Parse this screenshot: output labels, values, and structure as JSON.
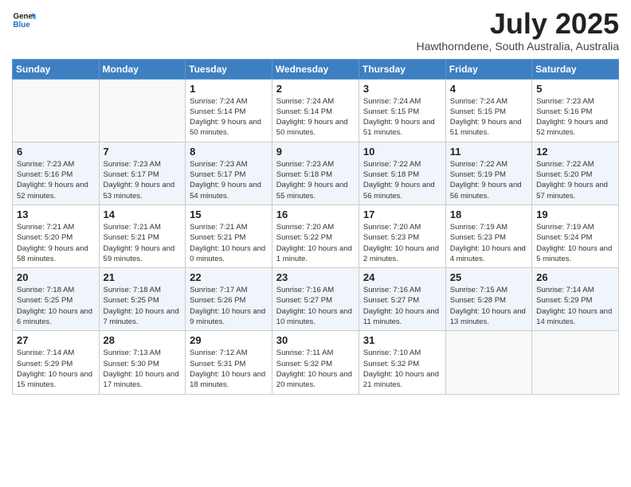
{
  "header": {
    "logo_line1": "General",
    "logo_line2": "Blue",
    "month_year": "July 2025",
    "location": "Hawthorndene, South Australia, Australia"
  },
  "weekdays": [
    "Sunday",
    "Monday",
    "Tuesday",
    "Wednesday",
    "Thursday",
    "Friday",
    "Saturday"
  ],
  "weeks": [
    [
      {
        "day": "",
        "info": ""
      },
      {
        "day": "",
        "info": ""
      },
      {
        "day": "1",
        "info": "Sunrise: 7:24 AM\nSunset: 5:14 PM\nDaylight: 9 hours and 50 minutes."
      },
      {
        "day": "2",
        "info": "Sunrise: 7:24 AM\nSunset: 5:14 PM\nDaylight: 9 hours and 50 minutes."
      },
      {
        "day": "3",
        "info": "Sunrise: 7:24 AM\nSunset: 5:15 PM\nDaylight: 9 hours and 51 minutes."
      },
      {
        "day": "4",
        "info": "Sunrise: 7:24 AM\nSunset: 5:15 PM\nDaylight: 9 hours and 51 minutes."
      },
      {
        "day": "5",
        "info": "Sunrise: 7:23 AM\nSunset: 5:16 PM\nDaylight: 9 hours and 52 minutes."
      }
    ],
    [
      {
        "day": "6",
        "info": "Sunrise: 7:23 AM\nSunset: 5:16 PM\nDaylight: 9 hours and 52 minutes."
      },
      {
        "day": "7",
        "info": "Sunrise: 7:23 AM\nSunset: 5:17 PM\nDaylight: 9 hours and 53 minutes."
      },
      {
        "day": "8",
        "info": "Sunrise: 7:23 AM\nSunset: 5:17 PM\nDaylight: 9 hours and 54 minutes."
      },
      {
        "day": "9",
        "info": "Sunrise: 7:23 AM\nSunset: 5:18 PM\nDaylight: 9 hours and 55 minutes."
      },
      {
        "day": "10",
        "info": "Sunrise: 7:22 AM\nSunset: 5:18 PM\nDaylight: 9 hours and 56 minutes."
      },
      {
        "day": "11",
        "info": "Sunrise: 7:22 AM\nSunset: 5:19 PM\nDaylight: 9 hours and 56 minutes."
      },
      {
        "day": "12",
        "info": "Sunrise: 7:22 AM\nSunset: 5:20 PM\nDaylight: 9 hours and 57 minutes."
      }
    ],
    [
      {
        "day": "13",
        "info": "Sunrise: 7:21 AM\nSunset: 5:20 PM\nDaylight: 9 hours and 58 minutes."
      },
      {
        "day": "14",
        "info": "Sunrise: 7:21 AM\nSunset: 5:21 PM\nDaylight: 9 hours and 59 minutes."
      },
      {
        "day": "15",
        "info": "Sunrise: 7:21 AM\nSunset: 5:21 PM\nDaylight: 10 hours and 0 minutes."
      },
      {
        "day": "16",
        "info": "Sunrise: 7:20 AM\nSunset: 5:22 PM\nDaylight: 10 hours and 1 minute."
      },
      {
        "day": "17",
        "info": "Sunrise: 7:20 AM\nSunset: 5:23 PM\nDaylight: 10 hours and 2 minutes."
      },
      {
        "day": "18",
        "info": "Sunrise: 7:19 AM\nSunset: 5:23 PM\nDaylight: 10 hours and 4 minutes."
      },
      {
        "day": "19",
        "info": "Sunrise: 7:19 AM\nSunset: 5:24 PM\nDaylight: 10 hours and 5 minutes."
      }
    ],
    [
      {
        "day": "20",
        "info": "Sunrise: 7:18 AM\nSunset: 5:25 PM\nDaylight: 10 hours and 6 minutes."
      },
      {
        "day": "21",
        "info": "Sunrise: 7:18 AM\nSunset: 5:25 PM\nDaylight: 10 hours and 7 minutes."
      },
      {
        "day": "22",
        "info": "Sunrise: 7:17 AM\nSunset: 5:26 PM\nDaylight: 10 hours and 9 minutes."
      },
      {
        "day": "23",
        "info": "Sunrise: 7:16 AM\nSunset: 5:27 PM\nDaylight: 10 hours and 10 minutes."
      },
      {
        "day": "24",
        "info": "Sunrise: 7:16 AM\nSunset: 5:27 PM\nDaylight: 10 hours and 11 minutes."
      },
      {
        "day": "25",
        "info": "Sunrise: 7:15 AM\nSunset: 5:28 PM\nDaylight: 10 hours and 13 minutes."
      },
      {
        "day": "26",
        "info": "Sunrise: 7:14 AM\nSunset: 5:29 PM\nDaylight: 10 hours and 14 minutes."
      }
    ],
    [
      {
        "day": "27",
        "info": "Sunrise: 7:14 AM\nSunset: 5:29 PM\nDaylight: 10 hours and 15 minutes."
      },
      {
        "day": "28",
        "info": "Sunrise: 7:13 AM\nSunset: 5:30 PM\nDaylight: 10 hours and 17 minutes."
      },
      {
        "day": "29",
        "info": "Sunrise: 7:12 AM\nSunset: 5:31 PM\nDaylight: 10 hours and 18 minutes."
      },
      {
        "day": "30",
        "info": "Sunrise: 7:11 AM\nSunset: 5:32 PM\nDaylight: 10 hours and 20 minutes."
      },
      {
        "day": "31",
        "info": "Sunrise: 7:10 AM\nSunset: 5:32 PM\nDaylight: 10 hours and 21 minutes."
      },
      {
        "day": "",
        "info": ""
      },
      {
        "day": "",
        "info": ""
      }
    ]
  ]
}
